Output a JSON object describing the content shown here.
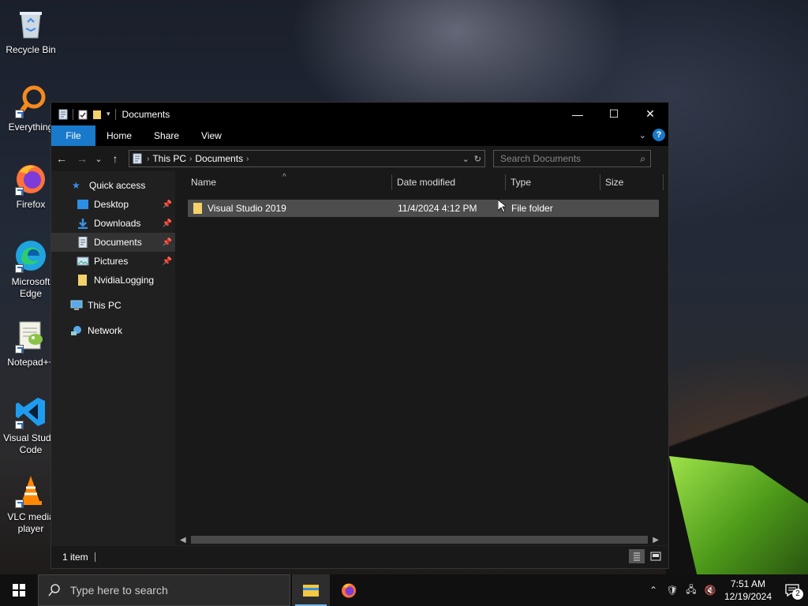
{
  "desktop": {
    "icons": [
      {
        "label": "Recycle Bin"
      },
      {
        "label": "Everything"
      },
      {
        "label": "Firefox"
      },
      {
        "label": "Microsoft Edge"
      },
      {
        "label": "Notepad++"
      },
      {
        "label": "Visual Studio Code"
      },
      {
        "label": "VLC media player"
      }
    ]
  },
  "window": {
    "title": "Documents",
    "controls": {
      "minimize": "—",
      "maximize": "☐",
      "close": "✕"
    },
    "ribbon_tabs": [
      "File",
      "Home",
      "Share",
      "View"
    ],
    "nav": {
      "back": "←",
      "forward": "→",
      "recent": "⌄",
      "up": "↑"
    },
    "breadcrumb": [
      "This PC",
      "Documents"
    ],
    "search_placeholder": "Search Documents",
    "navpane": {
      "quick_access": "Quick access",
      "pinned": [
        "Desktop",
        "Downloads",
        "Documents",
        "Pictures"
      ],
      "unpinned": [
        "NvidiaLogging"
      ],
      "this_pc": "This PC",
      "network": "Network"
    },
    "columns": [
      "Name",
      "Date modified",
      "Type",
      "Size"
    ],
    "rows": [
      {
        "name": "Visual Studio 2019",
        "date": "11/4/2024 4:12 PM",
        "type": "File folder",
        "size": ""
      }
    ],
    "status": "1 item"
  },
  "taskbar": {
    "search_placeholder": "Type here to search",
    "time": "7:51 AM",
    "date": "12/19/2024",
    "notification_count": "2"
  },
  "colors": {
    "accent": "#1979ca",
    "folder": "#f3d16b",
    "selection": "#4d4d4d"
  }
}
